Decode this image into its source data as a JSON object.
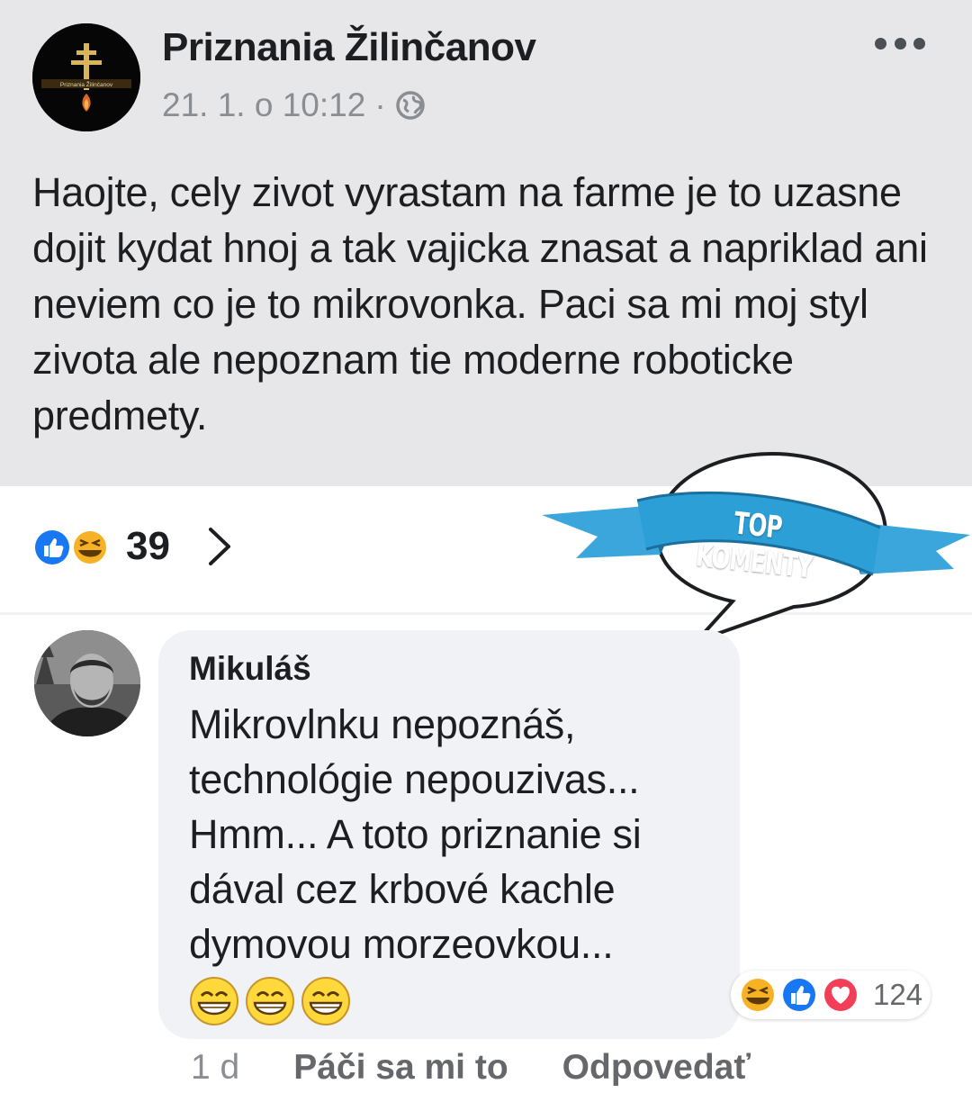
{
  "post": {
    "page_name": "Priznania Žilinčanov",
    "timestamp": "21. 1. o 10:12",
    "separator": "·",
    "avatar_text": "Priznania Žilinčanov",
    "text": "Haojte, cely zivot vyrastam na farme je to uzasne dojit kydat hnoj a tak vajicka znasat a napriklad ani neviem co je to mikrovonka. Paci sa mi moj styl zivota ale nepoznam tie moderne roboticke predmety."
  },
  "reactions": {
    "icons": [
      "like-icon",
      "haha-icon"
    ],
    "count": "39"
  },
  "badge": {
    "label": "TOP KOMENTY"
  },
  "comment": {
    "author": "Mikuláš",
    "text": "Mikrovlnku nepoznáš, technológie nepouzivas... Hmm... A toto priznanie si dával cez krbové kachle dymovou morzeovkou...",
    "emojis": [
      "grin-icon",
      "grin-icon",
      "grin-icon"
    ],
    "reactions": {
      "icons": [
        "haha-icon",
        "like-icon",
        "love-icon"
      ],
      "count": "124"
    },
    "time": "1 d",
    "like_label": "Páči sa mi to",
    "reply_label": "Odpovedať"
  },
  "colors": {
    "post_bg": "#e7e7e9",
    "bubble_bg": "#f0f2f5",
    "like_blue": "#1877f2",
    "love_red": "#f33e58",
    "haha_yellow": "#f7b125",
    "ribbon_blue": "#2b9fd6"
  }
}
